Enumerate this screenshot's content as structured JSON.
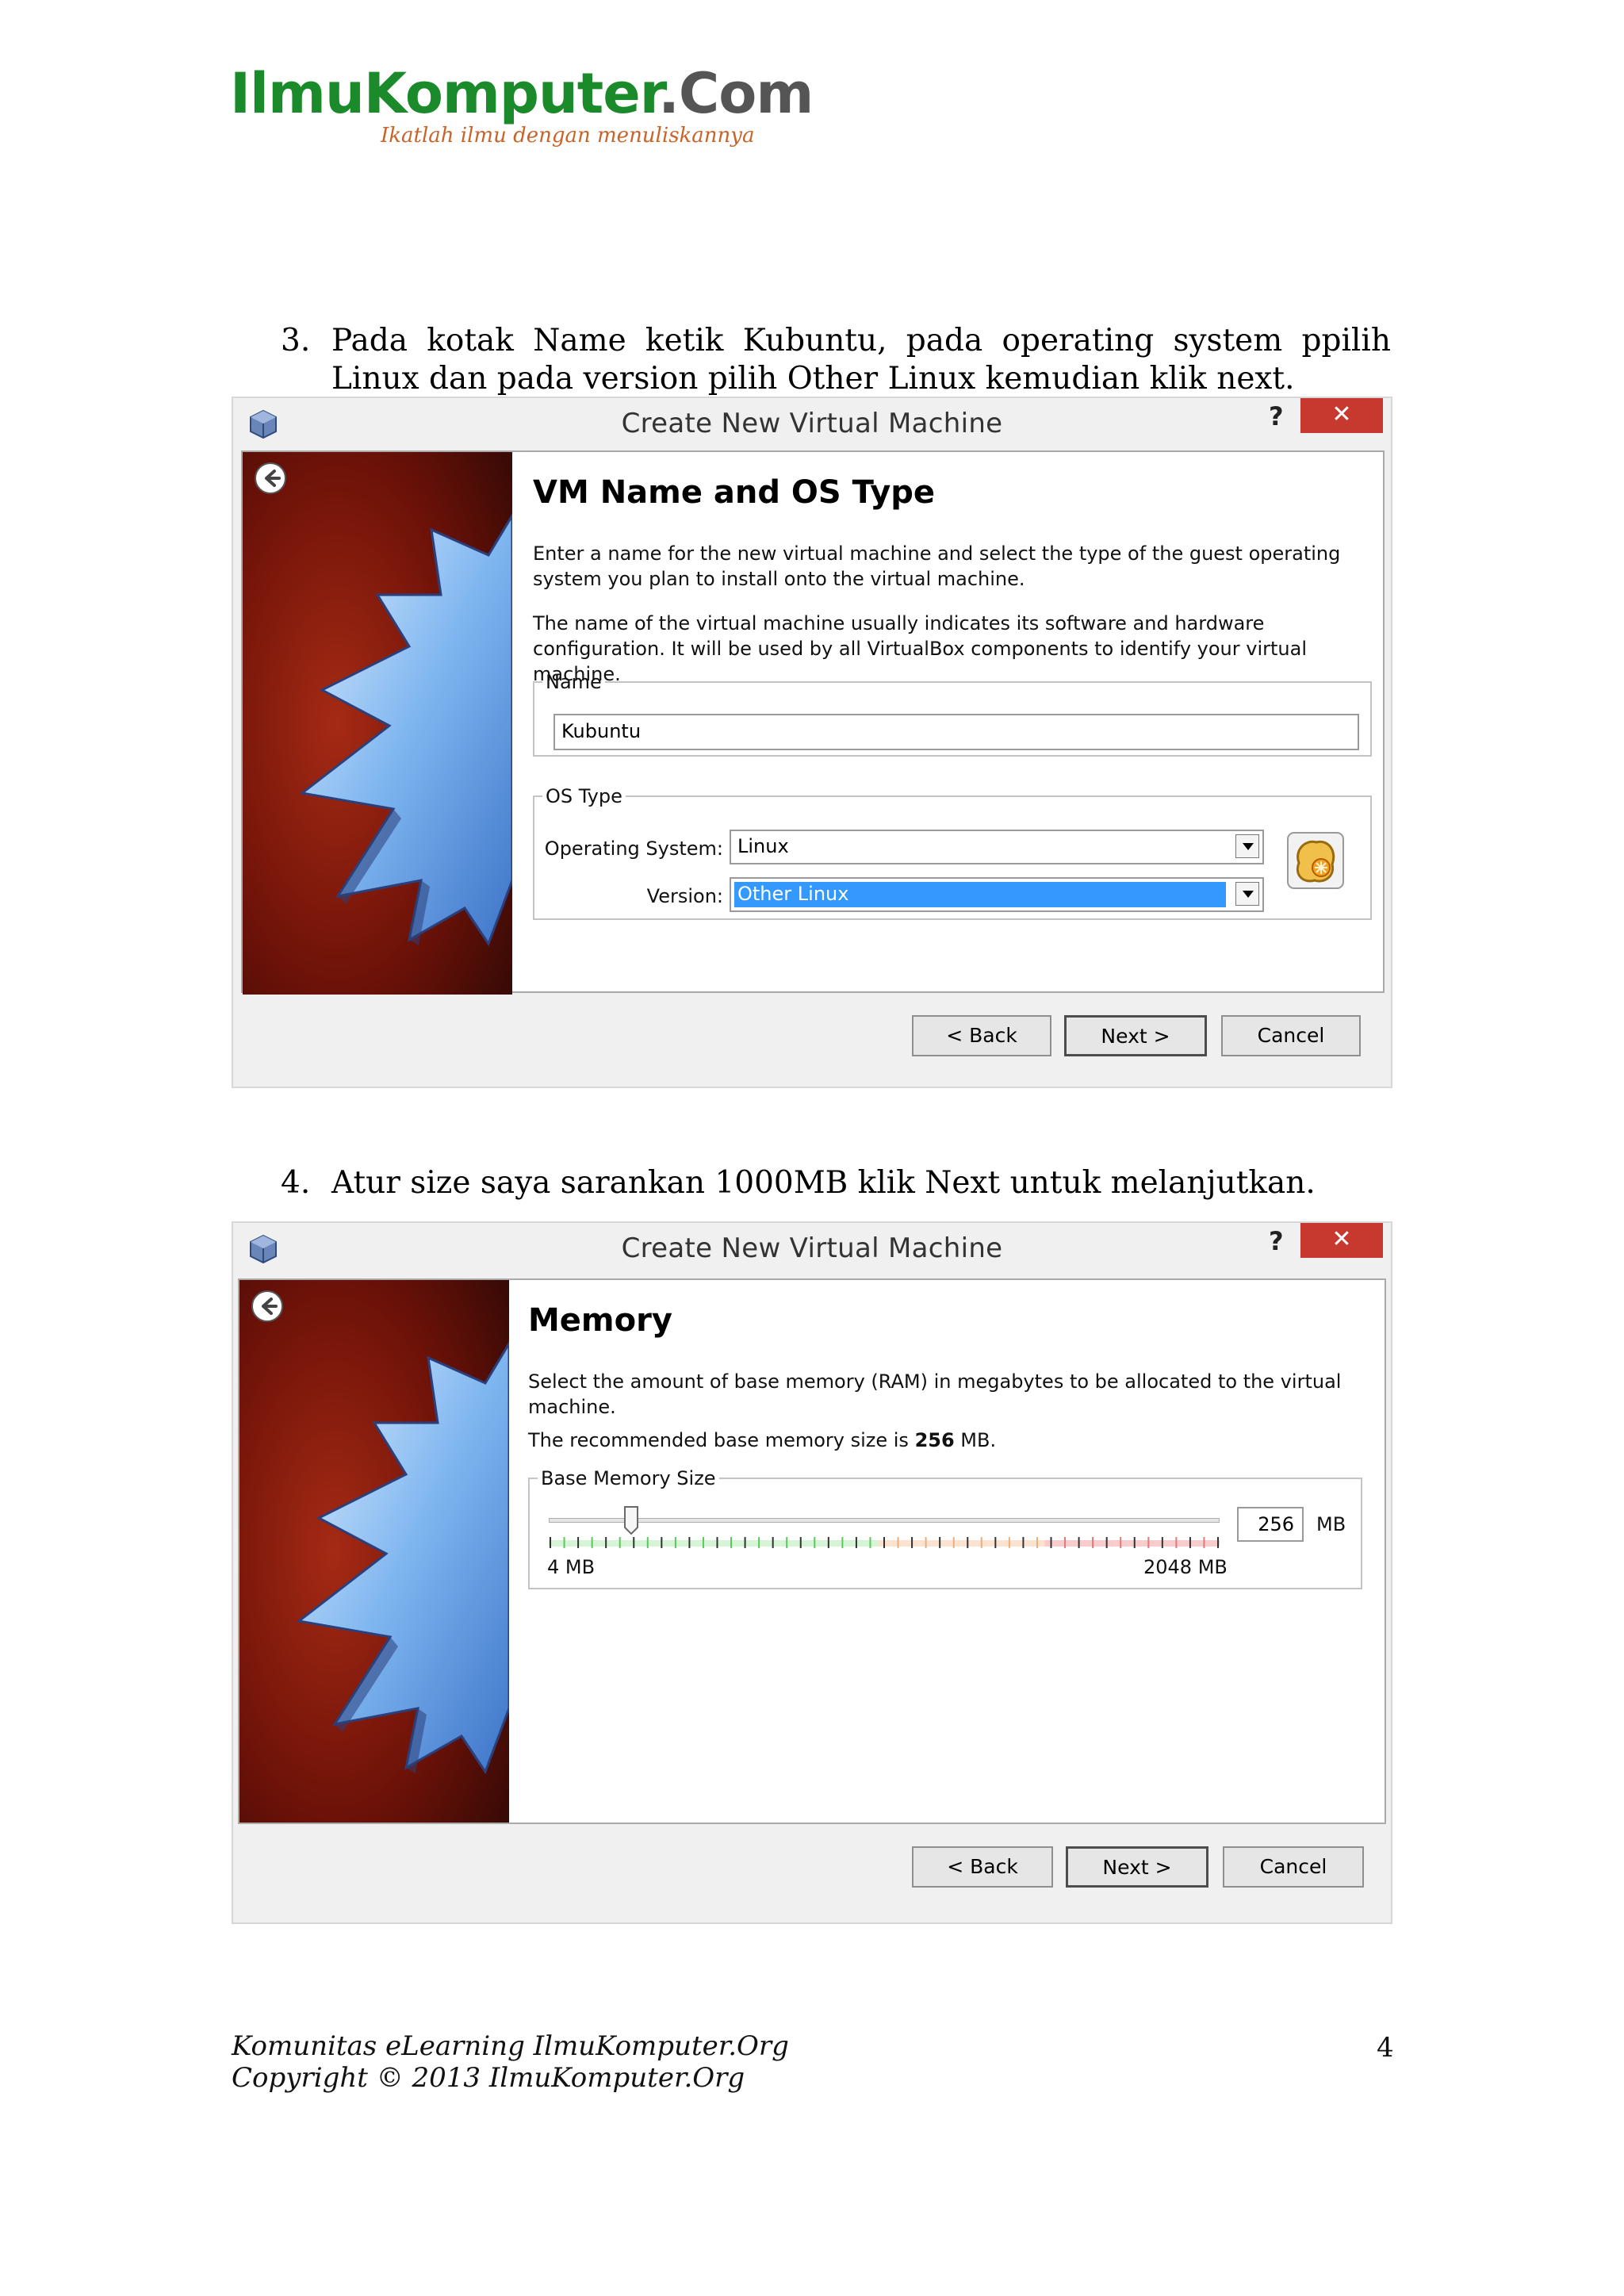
{
  "header": {
    "logo_text": "IlmuKomputer",
    "logo_suffix": ".Com",
    "tagline": "Ikatlah ilmu dengan menuliskannya"
  },
  "steps": [
    {
      "number": "3.",
      "text": "Pada kotak Name ketik Kubuntu, pada operating system ppilih Linux dan pada version pilih Other Linux kemudian klik next."
    },
    {
      "number": "4.",
      "text": "Atur size saya sarankan 1000MB klik Next untuk melanjutkan."
    }
  ],
  "dialog1": {
    "title": "Create New Virtual Machine",
    "help": "?",
    "close": "✕",
    "heading": "VM Name and OS Type",
    "para1": "Enter a name for the new virtual machine and select the type of the guest operating system you plan to install onto the virtual machine.",
    "para2": "The name of the virtual machine usually indicates its software and hardware configuration. It will be used by all VirtualBox components to identify your virtual machine.",
    "name_group": "Name",
    "name_value": "Kubuntu",
    "os_group": "OS Type",
    "os_label": "Operating System:",
    "os_value": "Linux",
    "version_label": "Version:",
    "version_value": "Other Linux",
    "back": "< Back",
    "next": "Next >",
    "cancel": "Cancel"
  },
  "dialog2": {
    "title": "Create New Virtual Machine",
    "help": "?",
    "close": "✕",
    "heading": "Memory",
    "para1": "Select the amount of base memory (RAM) in megabytes to be allocated to the virtual machine.",
    "para2_prefix": "The recommended base memory size is ",
    "para2_value": "256",
    "para2_suffix": " MB.",
    "group": "Base Memory Size",
    "memory_value": "256",
    "memory_unit": "MB",
    "min_label": "4 MB",
    "max_label": "2048 MB",
    "slider": {
      "min": 4,
      "max": 2048,
      "value": 256
    },
    "back": "< Back",
    "next": "Next >",
    "cancel": "Cancel"
  },
  "footer": {
    "line1": "Komunitas eLearning IlmuKomputer.Org",
    "line2": "Copyright © 2013 IlmuKomputer.Org",
    "page_number": "4"
  },
  "colors": {
    "logo_green": "#1a8a2a",
    "tagline_orange": "#c8642a",
    "close_red": "#c7392e",
    "selection_blue": "#3399ff"
  }
}
